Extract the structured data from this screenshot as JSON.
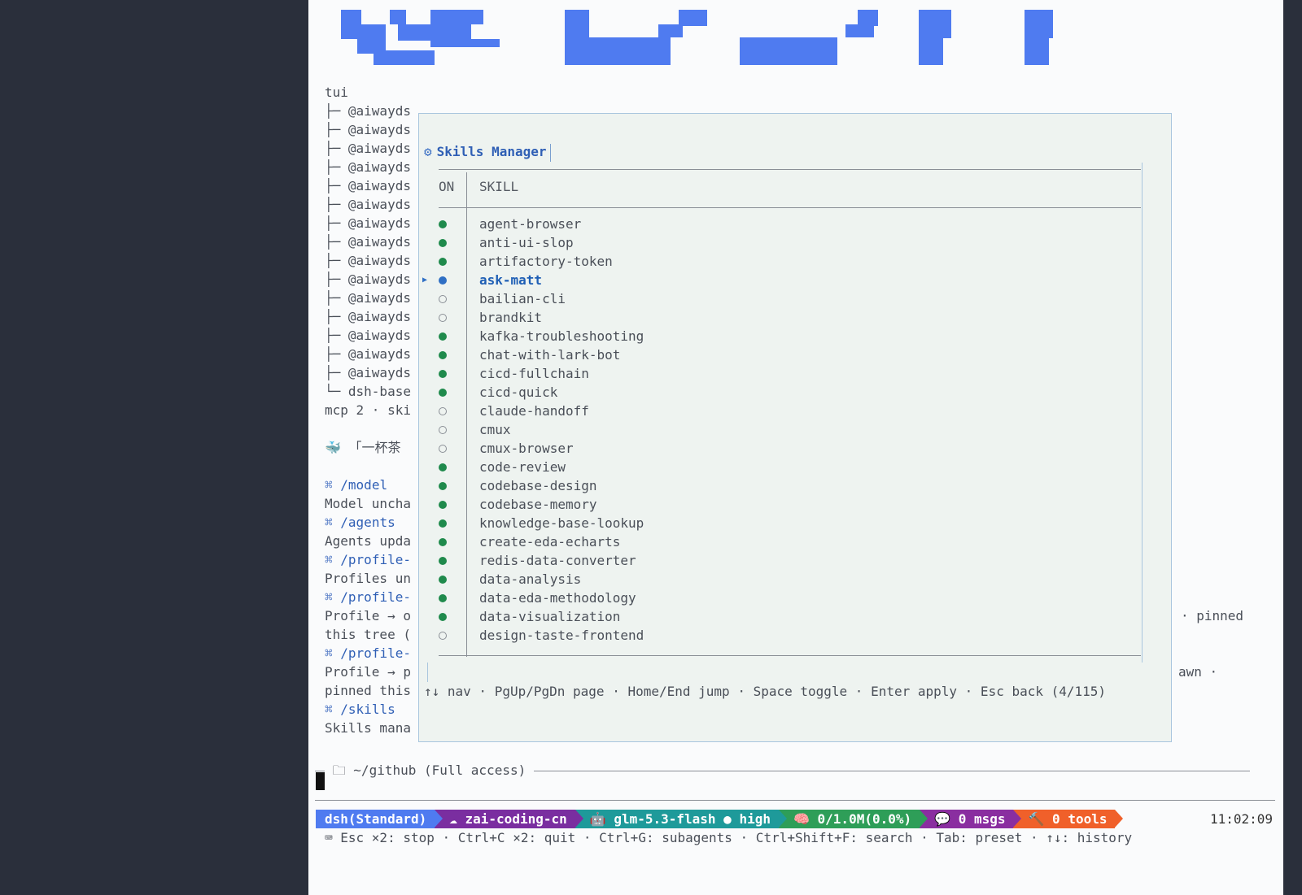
{
  "colors": {
    "accent": "#2f5fb5",
    "logo": "#4f7bf0",
    "on": "#1f8a4c",
    "seg1": "#4f7bf0",
    "seg2": "#7a2ea0",
    "seg3": "#1e9a9a",
    "seg4": "#2e9e58",
    "seg5": "#8a2ea0",
    "seg6": "#f0602a"
  },
  "tree": {
    "root": "tui",
    "items": [
      "├─ @aiwayds",
      "├─ @aiwayds",
      "├─ @aiwayds",
      "├─ @aiwayds",
      "├─ @aiwayds",
      "├─ @aiwayds",
      "├─ @aiwayds",
      "├─ @aiwayds",
      "├─ @aiwayds",
      "├─ @aiwayds",
      "├─ @aiwayds",
      "├─ @aiwayds",
      "├─ @aiwayds",
      "├─ @aiwayds",
      "├─ @aiwayds",
      "└─ dsh-base"
    ],
    "summary": "mcp 2 · ski"
  },
  "tip": "🐳 「一杯茶",
  "history": [
    {
      "type": "cmd",
      "mark": "⌘",
      "text": "/model"
    },
    {
      "type": "text",
      "text": "Model uncha"
    },
    {
      "type": "cmd",
      "mark": "⌘",
      "text": "/agents"
    },
    {
      "type": "text",
      "text": "Agents upda"
    },
    {
      "type": "cmd",
      "mark": "⌘",
      "text": "/profile-"
    },
    {
      "type": "text",
      "text": "Profiles un"
    },
    {
      "type": "cmd",
      "mark": "⌘",
      "text": "/profile-"
    },
    {
      "type": "text",
      "text": "Profile → o"
    },
    {
      "type": "text",
      "text": "this tree ("
    },
    {
      "type": "cmd",
      "mark": "⌘",
      "text": "/profile-"
    },
    {
      "type": "text",
      "text": "Profile → p"
    },
    {
      "type": "text",
      "text": "pinned this"
    },
    {
      "type": "cmd",
      "mark": "⌘",
      "text": "/skills"
    },
    {
      "type": "text",
      "text": "Skills mana"
    }
  ],
  "right_fragments": {
    "pinned": "· pinned",
    "awn": "awn ·"
  },
  "modal": {
    "icon": "gear-icon",
    "title": "Skills Manager",
    "col_on": "ON",
    "col_skill": "SKILL",
    "skills": [
      {
        "name": "agent-browser",
        "on": true,
        "selected": false
      },
      {
        "name": "anti-ui-slop",
        "on": true,
        "selected": false
      },
      {
        "name": "artifactory-token",
        "on": true,
        "selected": false
      },
      {
        "name": "ask-matt",
        "on": true,
        "selected": true
      },
      {
        "name": "bailian-cli",
        "on": false,
        "selected": false
      },
      {
        "name": "brandkit",
        "on": false,
        "selected": false
      },
      {
        "name": "kafka-troubleshooting",
        "on": true,
        "selected": false
      },
      {
        "name": "chat-with-lark-bot",
        "on": true,
        "selected": false
      },
      {
        "name": "cicd-fullchain",
        "on": true,
        "selected": false
      },
      {
        "name": "cicd-quick",
        "on": true,
        "selected": false
      },
      {
        "name": "claude-handoff",
        "on": false,
        "selected": false
      },
      {
        "name": "cmux",
        "on": false,
        "selected": false
      },
      {
        "name": "cmux-browser",
        "on": false,
        "selected": false
      },
      {
        "name": "code-review",
        "on": true,
        "selected": false
      },
      {
        "name": "codebase-design",
        "on": true,
        "selected": false
      },
      {
        "name": "codebase-memory",
        "on": true,
        "selected": false
      },
      {
        "name": "knowledge-base-lookup",
        "on": true,
        "selected": false
      },
      {
        "name": "create-eda-echarts",
        "on": true,
        "selected": false
      },
      {
        "name": "redis-data-converter",
        "on": true,
        "selected": false
      },
      {
        "name": "data-analysis",
        "on": true,
        "selected": false
      },
      {
        "name": "data-eda-methodology",
        "on": true,
        "selected": false
      },
      {
        "name": "data-visualization",
        "on": true,
        "selected": false
      },
      {
        "name": "design-taste-frontend",
        "on": false,
        "selected": false
      }
    ],
    "help": "↑↓ nav · PgUp/PgDn page · Home/End jump · Space toggle · Enter apply · Esc back (4/115)"
  },
  "cwd": {
    "icon": "folder-icon",
    "text": "~/github (Full access)"
  },
  "status": {
    "segments": [
      {
        "name": "profile",
        "icon": "",
        "text": "dsh(Standard)",
        "color": "#4f7bf0"
      },
      {
        "name": "provider",
        "icon": "☁",
        "text": "zai-coding-cn",
        "color": "#7a2ea0"
      },
      {
        "name": "model",
        "icon": "🤖",
        "text": "glm-5.3-flash ● high",
        "color": "#1e9a9a"
      },
      {
        "name": "context",
        "icon": "🧠",
        "text": "0/1.0M(0.0%)",
        "color": "#2e9e58"
      },
      {
        "name": "msgs",
        "icon": "💬",
        "text": "0 msgs",
        "color": "#8a2ea0"
      },
      {
        "name": "tools",
        "icon": "🔨",
        "text": "0 tools",
        "color": "#f0602a"
      }
    ],
    "clock": "11:02:09"
  },
  "hints": "⌨ Esc ×2: stop · Ctrl+C ×2: quit · Ctrl+G: subagents · Ctrl+Shift+F: search · Tab: preset · ↑↓: history"
}
